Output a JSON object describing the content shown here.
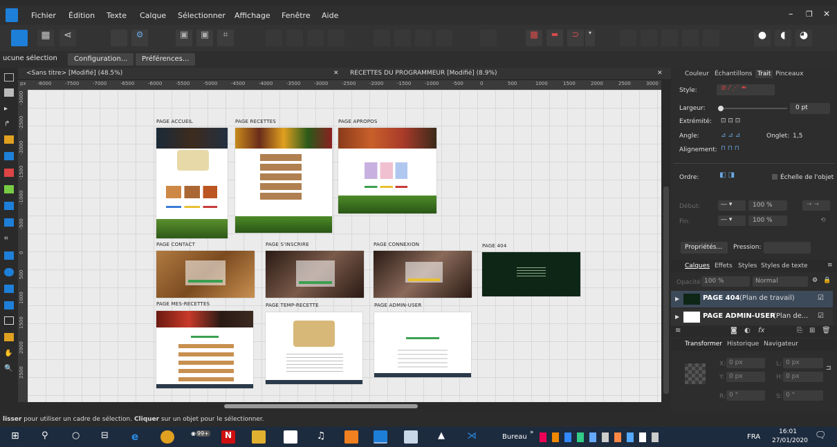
{
  "menu": [
    "Fichier",
    "Édition",
    "Texte",
    "Calque",
    "Sélectionner",
    "Affichage",
    "Fenêtre",
    "Aide"
  ],
  "context_bar": {
    "selection": "ucune sélection",
    "config": "Configuration...",
    "prefs": "Préférences..."
  },
  "doc_tabs": [
    {
      "label": "<Sans titre> [Modifié] (48.5%)"
    },
    {
      "label": "RECETTES DU PROGRAMMEUR [Modifié] (8.9%)"
    }
  ],
  "ruler": {
    "unit": "px",
    "h_ticks": [
      "-8000",
      "-7500",
      "-7000",
      "-6500",
      "-6000",
      "-5500",
      "-5000",
      "-4500",
      "-4000",
      "-3500",
      "-3000",
      "-2500",
      "-2000",
      "-1500",
      "-1000",
      "-500",
      "0",
      "500",
      "1000",
      "1500",
      "2000",
      "2500",
      "3000"
    ],
    "v_ticks": [
      "-3000",
      "-2500",
      "-2000",
      "-1500",
      "-1000",
      "-500",
      "0",
      "500",
      "1000",
      "1500",
      "2000",
      "2500"
    ]
  },
  "artboards": [
    {
      "label": "PAGE ACCUEIL"
    },
    {
      "label": "PAGE RECETTES"
    },
    {
      "label": "PAGE APROPOS"
    },
    {
      "label": "PAGE CONTACT"
    },
    {
      "label": "PAGE S'INSCRIRE"
    },
    {
      "label": "PAGE CONNEXION"
    },
    {
      "label": "PAGE 404"
    },
    {
      "label": "PAGE MES-RECETTES"
    },
    {
      "label": "PAGE TEMP-RECETTE"
    },
    {
      "label": "PAGE ADMIN-USER"
    }
  ],
  "panel_top_tabs": [
    "Couleur",
    "Échantillons",
    "Trait",
    "Pinceaux"
  ],
  "stroke": {
    "style_label": "Style:",
    "width_label": "Largeur:",
    "width_value": "0 pt",
    "cap_label": "Extrémité:",
    "angle_label": "Angle:",
    "miter_label": "Onglet:",
    "miter_value": "1,5",
    "align_label": "Alignement:",
    "order_label": "Ordre:",
    "scale_label": "Échelle de l'objet",
    "start_label": "Début:",
    "end_label": "Fin:",
    "start_pct": "100 %",
    "end_pct": "100 %",
    "props_btn": "Propriétés...",
    "pressure_label": "Pression:"
  },
  "layers_tabs": [
    "Calques",
    "Effets",
    "Styles",
    "Styles de texte"
  ],
  "layers_controls": {
    "opacity_label": "Opacité:",
    "opacity": "100 %",
    "blend": "Normal"
  },
  "layers": [
    {
      "name": "PAGE 404",
      "type": "(Plan de travail)"
    },
    {
      "name": "PAGE ADMIN-USER",
      "type": "(Plan de..."
    }
  ],
  "transform_tabs": [
    "Transformer",
    "Historique",
    "Navigateur"
  ],
  "transform": {
    "x_label": "X:",
    "x": "0 px",
    "y_label": "Y:",
    "y": "0 px",
    "w_label": "L:",
    "w": "0 px",
    "h_label": "H:",
    "h": "0 px",
    "r_label": "R:",
    "r": "0 °",
    "s_label": "S:",
    "s": "0 °"
  },
  "status": {
    "drag": "lisser",
    "rest1": " pour utiliser un cadre de sélection. ",
    "click": "Cliquer",
    "rest2": " sur un objet pour le sélectionner."
  },
  "taskbar": {
    "bureau": "Bureau",
    "lang": "FRA",
    "time": "16:01",
    "date": "27/01/2020",
    "badge": "99+"
  },
  "colors": {
    "accent": "#1e7fd8",
    "canvas": "#ebebeb",
    "panel": "#2d2d2d"
  }
}
